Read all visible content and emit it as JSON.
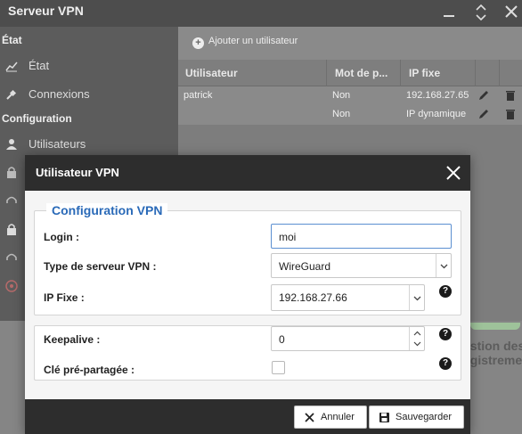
{
  "app": {
    "title": "Serveur VPN",
    "window_buttons": [
      "minimize",
      "restore",
      "close"
    ]
  },
  "sidebar": {
    "sections": [
      {
        "label": "État"
      },
      {
        "label": "Configuration"
      }
    ],
    "items": [
      {
        "label": "Etat",
        "icon": "chart-icon"
      },
      {
        "label": "Connexions",
        "icon": "plug-icon"
      },
      {
        "label": "Utilisateurs",
        "icon": "user-icon"
      }
    ],
    "state_item_label": "État"
  },
  "toolbar": {
    "add_user_label": "Ajouter un utilisateur"
  },
  "grid": {
    "columns": [
      "Utilisateur",
      "Mot de p...",
      "IP fixe"
    ],
    "rows": [
      {
        "user": "patrick",
        "pwd": "Non",
        "ip": "192.168.27.65"
      },
      {
        "user": "",
        "pwd": "Non",
        "ip": "IP dynamique"
      }
    ]
  },
  "background_peek": {
    "line1": "estion des",
    "line2": "egistreme"
  },
  "dialog": {
    "title": "Utilisateur VPN",
    "section_title": "Configuration VPN",
    "login_label": "Login :",
    "login_value": "moi",
    "server_type_label": "Type de serveur VPN :",
    "server_type_value": "WireGuard",
    "ip_label": "IP Fixe :",
    "ip_value": "192.168.27.66",
    "keepalive_label": "Keepalive :",
    "keepalive_value": "0",
    "psk_label": "Clé pré-partagée :",
    "psk_checked": false,
    "cancel_label": "Annuler",
    "save_label": "Sauvegarder"
  },
  "colors": {
    "accent": "#2a6ab8",
    "header_dark": "#2d2d2d"
  }
}
